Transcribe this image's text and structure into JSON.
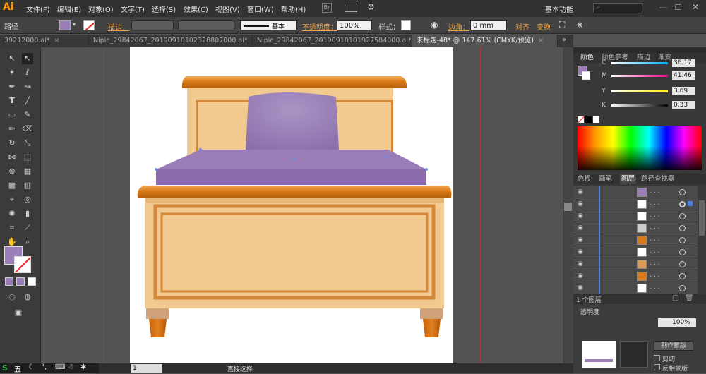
{
  "app": {
    "logo": "Ai",
    "menu": [
      "文件(F)",
      "编辑(E)",
      "对象(O)",
      "文字(T)",
      "选择(S)",
      "效果(C)",
      "视图(V)",
      "窗口(W)",
      "帮助(H)"
    ],
    "workspace": "基本功能",
    "window_controls": [
      "minimize-icon",
      "maximize-icon",
      "close-icon"
    ]
  },
  "control_bar": {
    "selection_label": "路径",
    "stroke_label": "描边：",
    "stroke_style": "基本",
    "opacity_label": "不透明度：",
    "opacity_value": "100%",
    "style_label": "样式：",
    "corner_label": "边角：",
    "corner_value": "0 mm",
    "align_label": "对齐",
    "transform_label": "变换"
  },
  "tabs": [
    {
      "label": "39212000.ai*",
      "active": false
    },
    {
      "label": "Nipic_29842067_20190910102328807000.ai*",
      "active": false
    },
    {
      "label": "Nipic_29842067_20190910101927584000.ai*",
      "active": false
    },
    {
      "label": "未标题-48* @ 147.61% (CMYK/预览)",
      "active": true
    }
  ],
  "color_panel": {
    "tabs": [
      "颜色",
      "颜色参考",
      "描边",
      "渐变"
    ],
    "channels": [
      {
        "name": "C",
        "value": "36.17",
        "pos": 0.36
      },
      {
        "name": "M",
        "value": "41.46",
        "pos": 0.41
      },
      {
        "name": "Y",
        "value": "3.69",
        "pos": 0.04
      },
      {
        "name": "K",
        "value": "0.33",
        "pos": 0.01
      }
    ],
    "fill_color": "#9b7db8"
  },
  "layers_panel": {
    "tabs": [
      "色板",
      "画笔",
      "图层",
      "路径查找器"
    ],
    "rows": [
      {
        "thumb": "#9b7db8",
        "selected": true
      },
      {
        "thumb": "#ffffff",
        "selected": false
      },
      {
        "thumb": "#ffffff",
        "selected": false
      },
      {
        "thumb": "#cccccc",
        "selected": false
      },
      {
        "thumb": "#d97a18",
        "selected": false
      },
      {
        "thumb": "#ffffff",
        "selected": false
      },
      {
        "thumb": "#d99a55",
        "selected": false
      },
      {
        "thumb": "#d97a18",
        "selected": false
      },
      {
        "thumb": "#ffffff",
        "selected": false
      }
    ],
    "count_label": "1 个图层"
  },
  "transparency_panel": {
    "title": "透明度",
    "opacity_value": "100%",
    "make_mask_button": "制作蒙版",
    "clip_label": "剪切",
    "invert_label": "反相蒙版"
  },
  "status": {
    "page": "1",
    "tool_status": "直接选择"
  },
  "ime": {
    "label": "五"
  },
  "colors": {
    "bed_light": "#f2c98f",
    "bed_frame": "#d4883a",
    "bed_orange": "#d97a18",
    "blanket": "#9b7db8",
    "pillow": "#a48bc2"
  }
}
